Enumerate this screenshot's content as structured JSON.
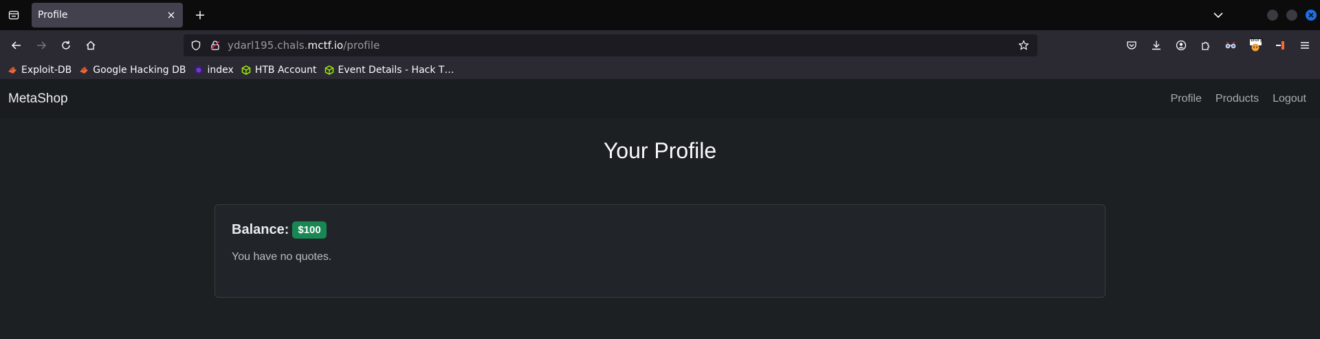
{
  "browser": {
    "tab_title": "Profile",
    "url_prefix": "ydarl195.chals.",
    "url_host": "mctf.io",
    "url_path": "/profile",
    "burp_label": "Burp",
    "bookmarks": [
      {
        "label": "Exploit-DB",
        "icon": "exploitdb-icon"
      },
      {
        "label": "Google Hacking DB",
        "icon": "ghdb-icon"
      },
      {
        "label": "index",
        "icon": "index-icon"
      },
      {
        "label": "HTB Account",
        "icon": "htb-icon"
      },
      {
        "label": "Event Details - Hack T…",
        "icon": "htb-icon"
      }
    ]
  },
  "site": {
    "brand": "MetaShop",
    "nav_links": [
      "Profile",
      "Products",
      "Logout"
    ]
  },
  "profile": {
    "heading": "Your Profile",
    "balance_label": "Balance:",
    "balance_value": "$100",
    "quotes_message": "You have no quotes."
  },
  "colors": {
    "accent_blue": "#1f6fe5",
    "badge_green": "#198754",
    "page_bg": "#1d2023"
  }
}
